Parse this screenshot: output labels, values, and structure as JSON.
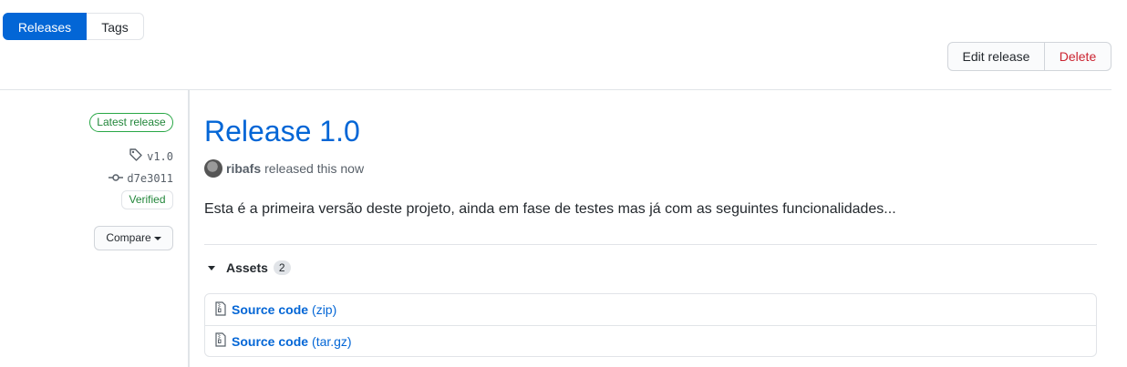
{
  "tabs": [
    {
      "label": "Releases",
      "active": true
    },
    {
      "label": "Tags",
      "active": false
    }
  ],
  "actions": {
    "edit_label": "Edit release",
    "delete_label": "Delete"
  },
  "sidebar": {
    "latest_label": "Latest release",
    "tag": "v1.0",
    "commit": "d7e3011",
    "verified_label": "Verified",
    "compare_label": "Compare"
  },
  "release": {
    "title": "Release 1.0",
    "author": "ribafs",
    "released_text": "released this now",
    "description": "Esta é a primeira versão deste projeto, ainda em fase de testes mas já com as seguintes funcionalidades..."
  },
  "assets": {
    "label": "Assets",
    "count": "2",
    "items": [
      {
        "name": "Source code",
        "ext": "(zip)"
      },
      {
        "name": "Source code",
        "ext": "(tar.gz)"
      }
    ]
  },
  "colors": {
    "accent": "#0366d6",
    "danger": "#cb2431",
    "success": "#22863a"
  }
}
